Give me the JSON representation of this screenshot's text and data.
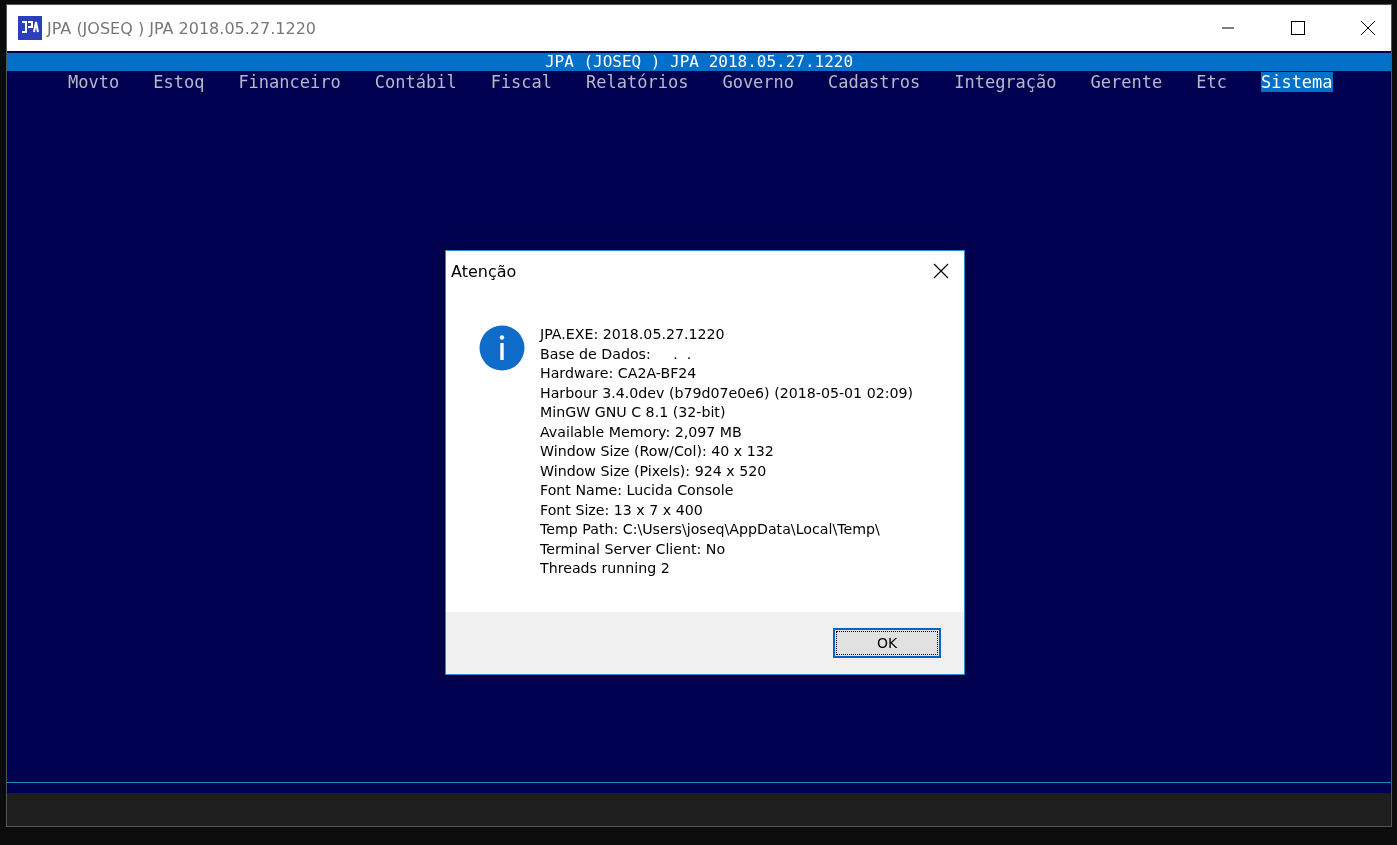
{
  "window": {
    "title": "JPA (JOSEQ ) JPA 2018.05.27.1220"
  },
  "console": {
    "header": "JPA (JOSEQ ) JPA 2018.05.27.1220",
    "menu": [
      {
        "label": "Movto",
        "selected": false
      },
      {
        "label": "Estoq",
        "selected": false
      },
      {
        "label": "Financeiro",
        "selected": false
      },
      {
        "label": "Contábil",
        "selected": false
      },
      {
        "label": "Fiscal",
        "selected": false
      },
      {
        "label": "Relatórios",
        "selected": false
      },
      {
        "label": "Governo",
        "selected": false
      },
      {
        "label": "Cadastros",
        "selected": false
      },
      {
        "label": "Integração",
        "selected": false
      },
      {
        "label": "Gerente",
        "selected": false
      },
      {
        "label": "Etc",
        "selected": false
      },
      {
        "label": "Sistema",
        "selected": true
      }
    ]
  },
  "dialog": {
    "title": "Atenção",
    "lines": [
      "JPA.EXE: 2018.05.27.1220",
      "Base de Dados:     .  .",
      "Hardware: CA2A-BF24",
      "Harbour 3.4.0dev (b79d07e0e6) (2018-05-01 02:09)",
      "MinGW GNU C 8.1 (32-bit)",
      "Available Memory: 2,097 MB",
      "Window Size (Row/Col): 40 x 132",
      "Window Size (Pixels): 924 x 520",
      "Font Name: Lucida Console",
      "Font Size: 13 x 7 x 400",
      "Temp Path: C:\\Users\\joseq\\AppData\\Local\\Temp\\",
      "Terminal Server Client: No",
      "Threads running 2"
    ],
    "button": "OK"
  }
}
